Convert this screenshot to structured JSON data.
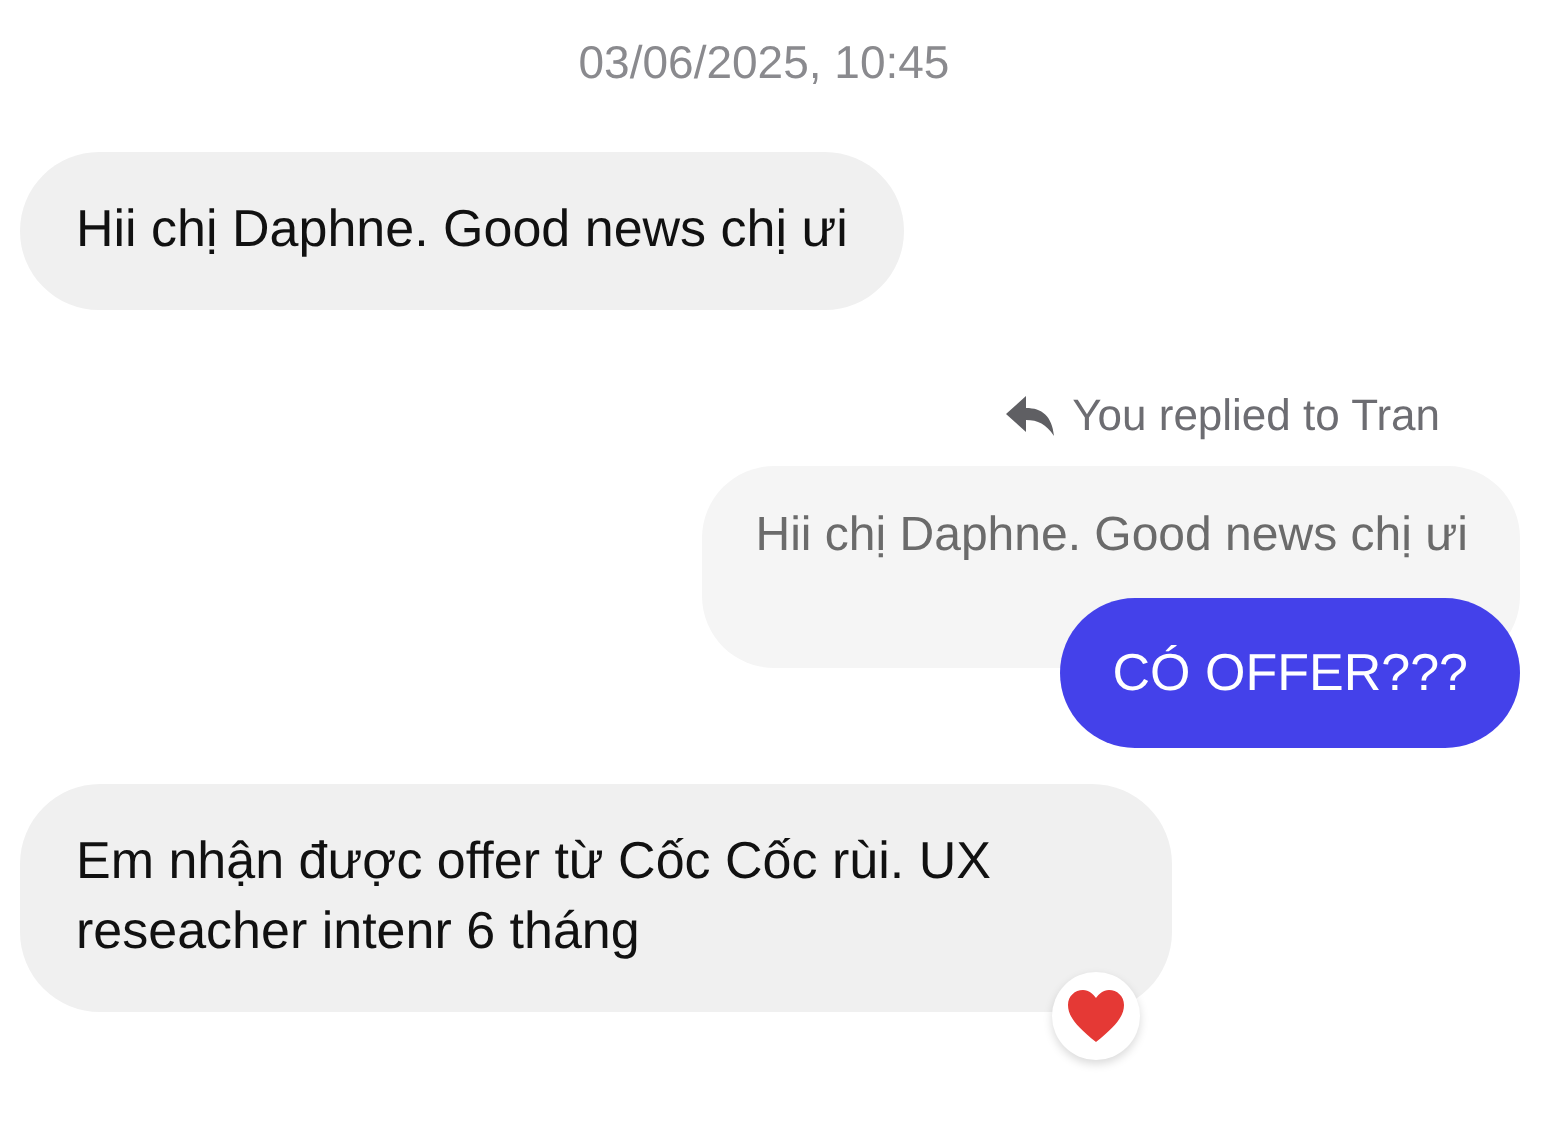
{
  "timestamp": "03/06/2025, 10:45",
  "messages": [
    {
      "kind": "incoming",
      "text": "Hii chị Daphne. Good news chị ưi",
      "reacted": false
    },
    {
      "kind": "reply",
      "label": "You replied to Tran",
      "quote": "Hii chị Daphne. Good news chị ưi",
      "text": "CÓ OFFER???"
    },
    {
      "kind": "incoming",
      "text": "Em nhận được offer từ Cốc Cốc rùi. UX reseacher intenr 6 tháng",
      "reacted": true
    }
  ]
}
